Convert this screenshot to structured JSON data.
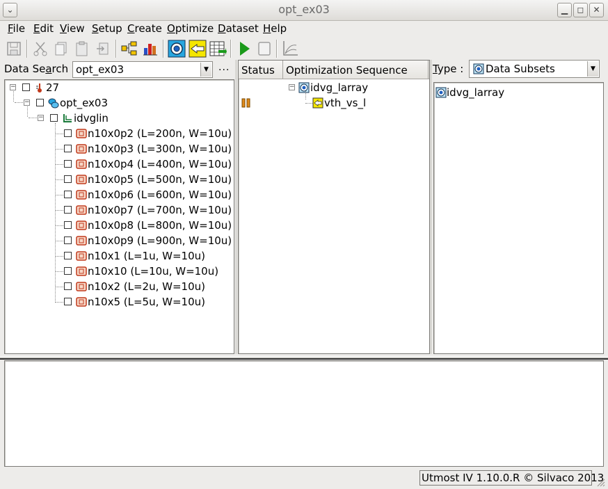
{
  "window": {
    "title": "opt_ex03",
    "controls": {
      "minimize": "▁",
      "maximize": "◻",
      "close": "✕"
    }
  },
  "menu": [
    {
      "label": "File",
      "mnemonic": "F",
      "rest": "ile"
    },
    {
      "label": "Edit",
      "mnemonic": "E",
      "rest": "dit"
    },
    {
      "label": "View",
      "mnemonic": "V",
      "rest": "iew"
    },
    {
      "label": "Setup",
      "mnemonic": "S",
      "rest": "etup"
    },
    {
      "label": "Create",
      "mnemonic": "C",
      "rest": "reate"
    },
    {
      "label": "Optimize",
      "mnemonic": "O",
      "rest": "ptimize"
    },
    {
      "label": "Dataset",
      "mnemonic": "D",
      "rest": "ataset"
    },
    {
      "label": "Help",
      "mnemonic": "H",
      "rest": "elp"
    }
  ],
  "toolbar": {
    "icons": [
      "save-icon",
      "cut-icon",
      "copy-icon",
      "paste-icon",
      "delete-icon",
      "hierarchy-icon",
      "bar-chart-icon",
      "target-icon",
      "arrow-left-icon",
      "spreadsheet-icon",
      "run-icon",
      "stop-icon",
      "plot-icon"
    ]
  },
  "left": {
    "search_label_pre": "Data Se",
    "search_label_mnemonic": "a",
    "search_label_post": "rch :",
    "search_value": "opt_ex03",
    "more_label": "...",
    "tree": {
      "root": "27",
      "project": "opt_ex03",
      "group": "idvglin",
      "devices": [
        "n10x0p2 (L=200n, W=10u)",
        "n10x0p3 (L=300n, W=10u)",
        "n10x0p4 (L=400n, W=10u)",
        "n10x0p5 (L=500n, W=10u)",
        "n10x0p6 (L=600n, W=10u)",
        "n10x0p7 (L=700n, W=10u)",
        "n10x0p8 (L=800n, W=10u)",
        "n10x0p9 (L=900n, W=10u)",
        "n10x1 (L=1u, W=10u)",
        "n10x10 (L=10u, W=10u)",
        "n10x2 (L=2u, W=10u)",
        "n10x5 (L=5u, W=10u)"
      ]
    }
  },
  "middle": {
    "col_status": "Status",
    "col_sequence": "Optimization Sequence",
    "sequence_root": "idvg_larray",
    "sequence_child": "vth_vs_l",
    "child_status_icon": "pause-icon"
  },
  "right": {
    "type_label_mnemonic": "T",
    "type_label_rest": "ype :",
    "type_value": "Data Subsets",
    "items": [
      "idvg_larray"
    ]
  },
  "status": {
    "text": "Utmost IV 1.10.0.R © Silvaco 2013"
  },
  "colors": {
    "background": "#edecea",
    "panel": "#ffffff",
    "run_green": "#1a9a1a",
    "device_icon": "#c0391b"
  }
}
